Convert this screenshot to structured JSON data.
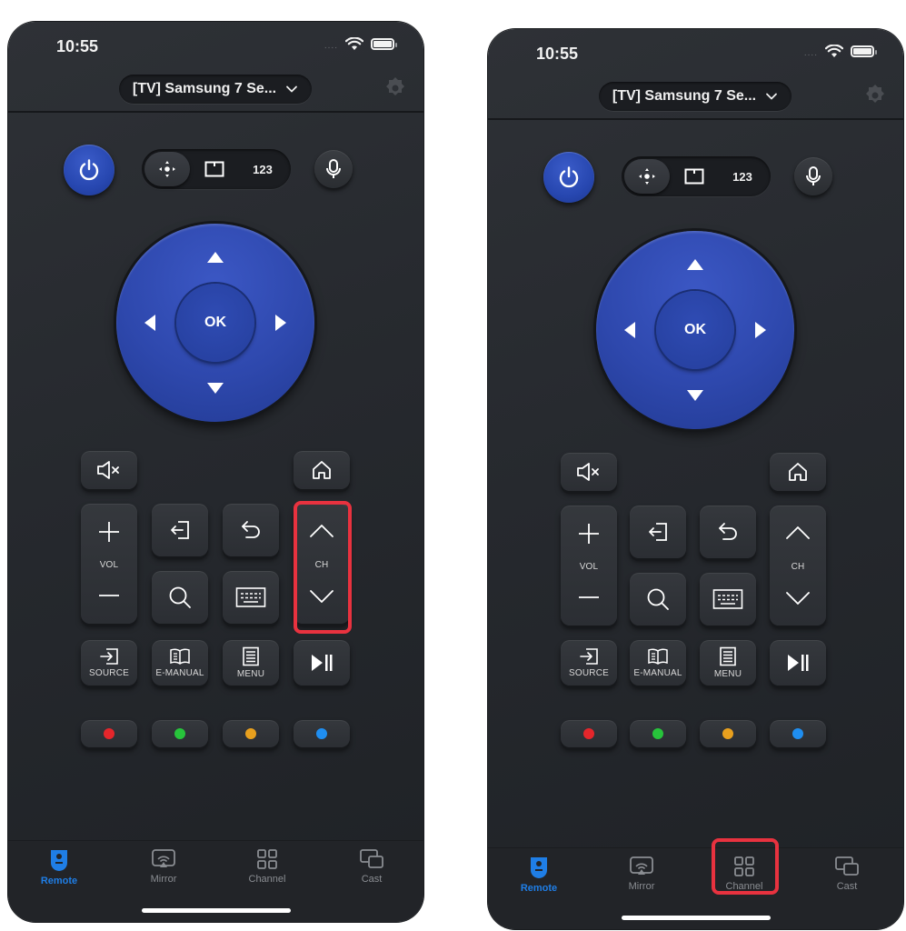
{
  "screens": [
    {
      "id": "left",
      "status_bar": {
        "time": "10:55",
        "signal": "....",
        "wifi_icon": "wifi-icon",
        "battery_icon": "battery-icon"
      },
      "header": {
        "device_name": "[TV] Samsung 7 Se...",
        "dropdown_icon": "chevron-down-icon",
        "settings_icon": "gear-icon"
      },
      "controls": {
        "power_icon": "power-icon",
        "modes": [
          {
            "name": "dpad-mode",
            "icon": "move-icon",
            "active": true
          },
          {
            "name": "touchpad-mode",
            "icon": "touchpad-icon",
            "active": false
          },
          {
            "name": "numpad-mode",
            "label": "123",
            "active": false
          }
        ],
        "mic_icon": "microphone-icon",
        "ok_label": "OK",
        "vol_label": "VOL",
        "ch_label": "CH",
        "source_label": "SOURCE",
        "emanual_label": "E-MANUAL",
        "menu_label": "MENU",
        "color_keys": [
          "#e5262b",
          "#27c43b",
          "#e8a01e",
          "#1f8ef0"
        ]
      },
      "highlight": "channel-rocker",
      "tabs": [
        {
          "label": "Remote",
          "icon": "remote-icon",
          "active": true
        },
        {
          "label": "Mirror",
          "icon": "mirror-icon",
          "active": false
        },
        {
          "label": "Channel",
          "icon": "grid-icon",
          "active": false
        },
        {
          "label": "Cast",
          "icon": "cast-icon",
          "active": false
        }
      ]
    },
    {
      "id": "right",
      "status_bar": {
        "time": "10:55",
        "signal": "....",
        "wifi_icon": "wifi-icon",
        "battery_icon": "battery-icon"
      },
      "header": {
        "device_name": "[TV] Samsung 7 Se...",
        "dropdown_icon": "chevron-down-icon",
        "settings_icon": "gear-icon"
      },
      "controls": {
        "power_icon": "power-icon",
        "modes": [
          {
            "name": "dpad-mode",
            "icon": "move-icon",
            "active": true
          },
          {
            "name": "touchpad-mode",
            "icon": "touchpad-icon",
            "active": false
          },
          {
            "name": "numpad-mode",
            "label": "123",
            "active": false
          }
        ],
        "mic_icon": "microphone-icon",
        "ok_label": "OK",
        "vol_label": "VOL",
        "ch_label": "CH",
        "source_label": "SOURCE",
        "emanual_label": "E-MANUAL",
        "menu_label": "MENU",
        "color_keys": [
          "#e5262b",
          "#27c43b",
          "#e8a01e",
          "#1f8ef0"
        ]
      },
      "highlight": "tab-channel",
      "tabs": [
        {
          "label": "Remote",
          "icon": "remote-icon",
          "active": true
        },
        {
          "label": "Mirror",
          "icon": "mirror-icon",
          "active": false
        },
        {
          "label": "Channel",
          "icon": "grid-icon",
          "active": false
        },
        {
          "label": "Cast",
          "icon": "cast-icon",
          "active": false
        }
      ]
    }
  ],
  "colors": {
    "accent": "#1f7ee6",
    "power": "#2747b0",
    "dpad": "#2e48ad",
    "highlight": "#e8323f"
  }
}
